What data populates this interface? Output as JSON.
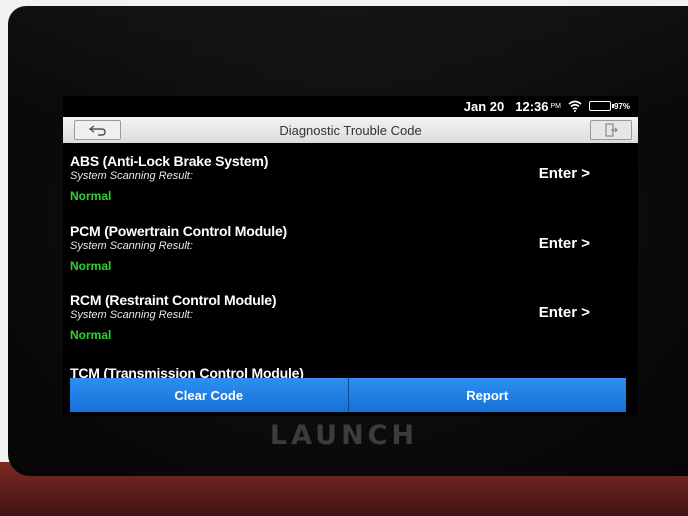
{
  "device": {
    "brand": "LAUNCH"
  },
  "status_bar": {
    "date": "Jan 20",
    "time": "12:36",
    "ampm": "PM",
    "battery": "97%",
    "battery_level": 0.97,
    "wifi_icon": "wifi-icon",
    "battery_icon": "battery-icon"
  },
  "header": {
    "title": "Diagnostic Trouble Code",
    "back_icon": "back-arrow-icon",
    "exit_icon": "exit-icon"
  },
  "modules": [
    {
      "name": "ABS (Anti-Lock Brake System)",
      "result_label": "System Scanning Result:",
      "result": "Normal",
      "action": "Enter >"
    },
    {
      "name": "PCM (Powertrain Control Module)",
      "result_label": "System Scanning Result:",
      "result": "Normal",
      "action": "Enter >"
    },
    {
      "name": "RCM (Restraint Control Module)",
      "result_label": "System Scanning Result:",
      "result": "Normal",
      "action": "Enter >"
    },
    {
      "name": "TCM (Transmission Control Module)"
    }
  ],
  "buttons": {
    "clear_code": "Clear Code",
    "report": "Report"
  },
  "colors": {
    "status_normal": "#2fd12f",
    "button_blue": "#1f80e6",
    "title_bar": "#e6e6e6"
  }
}
